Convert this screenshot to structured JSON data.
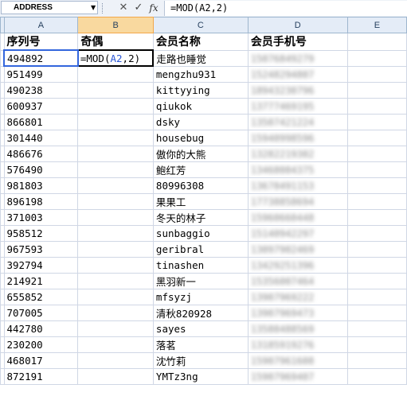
{
  "formula_bar": {
    "name_box": "ADDRESS",
    "cancel_glyph": "✕",
    "enter_glyph": "✓",
    "fx_glyph": "fx",
    "formula": "=MOD(A2,2)"
  },
  "columns": [
    "A",
    "B",
    "C",
    "D",
    "E"
  ],
  "headers": {
    "a": "序列号",
    "b": "奇偶",
    "c": "会员名称",
    "d": "会员手机号",
    "e": ""
  },
  "editing": {
    "prefix": "=MOD(",
    "ref": "A2",
    "suffix": ",2)"
  },
  "rows": [
    {
      "a": "494892",
      "c": "走路也睡觉",
      "d": "15076849279"
    },
    {
      "a": "951499",
      "c": "mengzhu931",
      "d": "15248294807"
    },
    {
      "a": "490238",
      "c": "kittyying",
      "d": "18943230796"
    },
    {
      "a": "600937",
      "c": "qiukok",
      "d": "13777469195"
    },
    {
      "a": "866801",
      "c": "dsky",
      "d": "13507421224"
    },
    {
      "a": "301440",
      "c": "housebug",
      "d": "15940998596"
    },
    {
      "a": "486676",
      "c": "傲你的大熊",
      "d": "13282219302"
    },
    {
      "a": "576490",
      "c": "鲍红芳",
      "d": "13468084375"
    },
    {
      "a": "981803",
      "c": "80996308",
      "d": "13678491153"
    },
    {
      "a": "896198",
      "c": "果果工",
      "d": "17738858694"
    },
    {
      "a": "371003",
      "c": "冬天的林子",
      "d": "15960660448"
    },
    {
      "a": "958512",
      "c": "sunbaggio",
      "d": "15140942297"
    },
    {
      "a": "967593",
      "c": "geribral",
      "d": "13097902469"
    },
    {
      "a": "392794",
      "c": "tinashen",
      "d": "13429251396"
    },
    {
      "a": "214921",
      "c": "黑羽新一",
      "d": "15356007464"
    },
    {
      "a": "655852",
      "c": "mfsyzj",
      "d": "13907969222"
    },
    {
      "a": "707005",
      "c": "清秋820928",
      "d": "13907969473"
    },
    {
      "a": "442780",
      "c": "sayes",
      "d": "13588488569"
    },
    {
      "a": "230200",
      "c": "落茗",
      "d": "13185919276"
    },
    {
      "a": "468017",
      "c": "沈竹莉",
      "d": "15907961608"
    },
    {
      "a": "872191",
      "c": "YMTz3ng",
      "d": "15907969407"
    }
  ]
}
